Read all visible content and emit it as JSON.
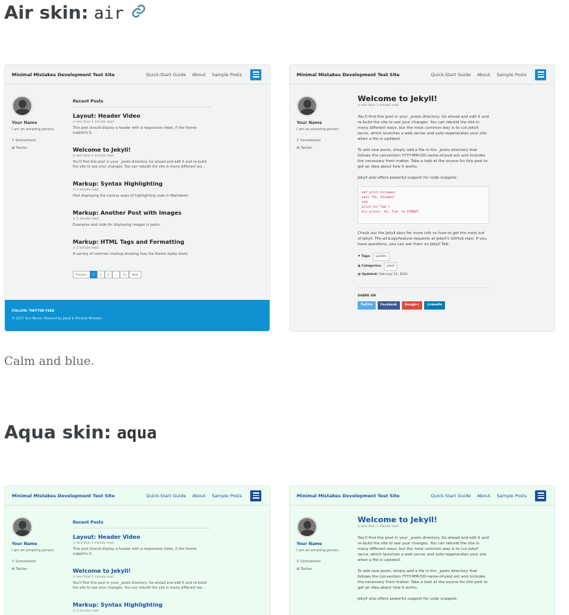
{
  "sections": [
    {
      "heading": "Air skin:",
      "code": "air",
      "caption": "Calm and blue."
    },
    {
      "heading": "Aqua skin:",
      "code": "aqua"
    }
  ],
  "shot": {
    "site_title": "Minimal Mistakes Development Test Site",
    "nav": [
      "Quick-Start Guide",
      "About",
      "Sample Posts"
    ],
    "author_name": "Your Name",
    "author_bio": "I am an amazing person.",
    "author_location": "Somewhere",
    "author_twitter": "Twitter",
    "recent_posts": "Recent Posts",
    "posts": [
      {
        "title": "Layout: Header Video",
        "read": "less than 1 minute read",
        "excerpt": "This post should display a header with a responsive video, if the theme supports it."
      },
      {
        "title": "Welcome to Jekyll!",
        "read": "less than 1 minute read",
        "excerpt": "You'll find this post in your _posts directory. Go ahead and edit it and re-build the site to see your changes. You can rebuild the site in many different wa..."
      },
      {
        "title": "Markup: Syntax Highlighting",
        "read": "1 minute read",
        "excerpt": "Post displaying the various ways of highlighting code in Markdown."
      },
      {
        "title": "Markup: Another Post with Images",
        "read": "1 minute read",
        "excerpt": "Examples and code for displaying images in posts."
      },
      {
        "title": "Markup: HTML Tags and Formatting",
        "read": "3 minute read",
        "excerpt": "A variety of common markup showing how the theme styles them."
      }
    ],
    "pager": [
      "Previous",
      "1",
      "2",
      "3",
      "...",
      "11",
      "Next"
    ],
    "footer_follow": "FOLLOW:  TWITTER   FEED",
    "footer_copy": "© 2017 Your Name. Powered by Jekyll & Minimal Mistakes.",
    "article_title": "Welcome to Jekyll!",
    "article_read": "less than 1 minute read",
    "article_p1": "You'll find this post in your _posts directory. Go ahead and edit it and re-build the site to see your changes. You can rebuild the site in many different ways, but the most common way is to run jekyll serve, which launches a web server and auto-regenerates your site when a file is updated.",
    "article_p2": "To add new posts, simply add a file in the _posts directory that follows the convention YYYY-MM-DD-name-of-post.ext and includes the necessary front matter. Take a look at the source for this post to get an idea about how it works.",
    "article_p3": "Jekyll also offers powerful support for code snippets:",
    "code_lines": [
      "def print_hi(name)",
      "  puts \"Hi, #{name}\"",
      "end",
      "print_hi('Tom')",
      "#=> prints 'Hi, Tom' to STDOUT."
    ],
    "article_p4": "Check out the Jekyll docs for more info on how to get the most out of Jekyll. File all bugs/feature requests at Jekyll's GitHub repo. If you have questions, you can ask them on Jekyll Talk.",
    "tags_label": "Tags:",
    "tag": "update",
    "categories_label": "Categories:",
    "category": "jekyll",
    "updated_label": "Updated:",
    "updated": "February 24, 2016",
    "share_label": "SHARE ON",
    "share_buttons": [
      "Twitter",
      "Facebook",
      "Google+",
      "LinkedIn"
    ]
  },
  "colors": {
    "air_footer": "#0f92d2",
    "aqua_bg": "#ebfdf1",
    "link_icon": "#4a8a9e"
  }
}
